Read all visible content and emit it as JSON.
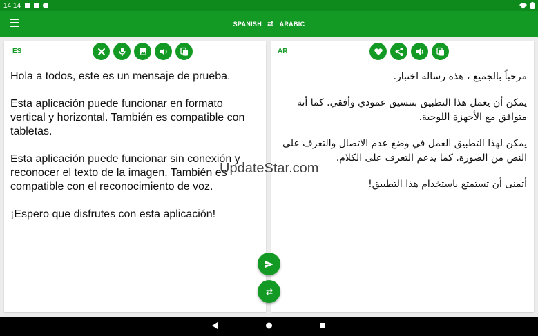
{
  "status": {
    "time": "14:14"
  },
  "header": {
    "source_lang": "SPANISH",
    "target_lang": "ARABIC",
    "swap_icon": "swap-arrows-icon"
  },
  "colors": {
    "primary": "#139a24",
    "status_bar": "#0d8a1b"
  },
  "source": {
    "code": "ES",
    "paragraphs": [
      "Hola a todos, este es un mensaje de prueba.",
      "Esta aplicación puede funcionar en formato vertical y horizontal. También es compatible con tabletas.",
      "Esta aplicación puede funcionar sin conexión y reconocer el texto de la imagen. También es compatible con el reconocimiento de voz.",
      "¡Espero que disfrutes con esta aplicación!"
    ],
    "toolbar": [
      "clear-icon",
      "microphone-icon",
      "image-icon",
      "speaker-icon",
      "copy-icon"
    ]
  },
  "target": {
    "code": "AR",
    "paragraphs": [
      "مرحباً بالجميع ، هذه رسالة اختبار.",
      "يمكن أن يعمل هذا التطبيق بتنسيق عمودي وأفقي. كما أنه متوافق مع الأجهزة اللوحية.",
      "يمكن لهذا التطبيق العمل في وضع عدم الاتصال والتعرف على النص من الصورة. كما يدعم التعرف على الكلام.",
      "أتمنى أن تستمتع باستخدام هذا التطبيق!"
    ],
    "toolbar": [
      "heart-icon",
      "share-icon",
      "speaker-icon",
      "copy-icon"
    ]
  },
  "watermark": "UpdateStar.com"
}
